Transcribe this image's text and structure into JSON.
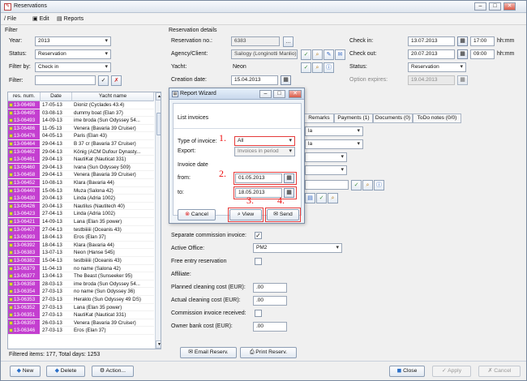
{
  "window": {
    "title": "Reservations"
  },
  "menu": {
    "file": "File",
    "edit": "Edit",
    "reports": "Reports"
  },
  "filter": {
    "section": "Filter",
    "year_label": "Year:",
    "year_value": "2013",
    "status_label": "Status:",
    "status_value": "Reservation",
    "filterby_label": "Filter by:",
    "filterby_value": "Check in",
    "filter_label": "Filter:",
    "filter_value": ""
  },
  "details": {
    "section": "Reservation details",
    "res_no_label": "Reservation no.:",
    "res_no_value": "6383",
    "agency_label": "Agency/Client:",
    "agency_value": "Sailogy (Longinotti Manlio)",
    "yacht_label": "Yacht:",
    "yacht_value": "Neon",
    "creation_label": "Creation date:",
    "creation_value": "15.04.2013",
    "checkin_label": "Check in:",
    "checkin_date": "13.07.2013",
    "checkin_time": "17:00",
    "checkin_unit": "hh:mm",
    "checkout_label": "Check out:",
    "checkout_date": "20.07.2013",
    "checkout_time": "09:00",
    "checkout_unit": "hh:mm",
    "status_label": "Status:",
    "status_value": "Reservation",
    "option_label": "Option expires:",
    "option_value": "19.04.2013"
  },
  "tabs": [
    "Remarks",
    "Payments (1)",
    "Documents (0)",
    "ToDo notes (0/0)"
  ],
  "form": {
    "combo_value": "la",
    "separate_commission": "Separate commission invoice:",
    "active_office_label": "Active Office:",
    "active_office_value": "PM2",
    "free_entry": "Free entry reservation",
    "affiliate": "Affiliate:",
    "planned_cleaning_label": "Planned cleaning cost (EUR):",
    "planned_cleaning_value": ".00",
    "actual_cleaning_label": "Actual cleaning cost (EUR):",
    "actual_cleaning_value": ".00",
    "commission_received": "Commission invoice received:",
    "owner_bank_label": "Owner bank cost (EUR):",
    "owner_bank_value": ".00",
    "email_button": "Email Reserv.",
    "print_button": "Print Reserv."
  },
  "grid": {
    "headers": [
      "res. num.",
      "Date",
      "Yacht name"
    ],
    "rows": [
      [
        "13-06498",
        "17-05-13",
        "Dioniz (Cyclades 43.4)"
      ],
      [
        "13-06495",
        "03-08-13",
        "dummy boat (Elan 37)"
      ],
      [
        "13-06493",
        "14-09-13",
        "ime broda (Sun Odyssey 54..."
      ],
      [
        "13-06486",
        "11-05-13",
        "Venera (Bavaria 39 Cruiser)"
      ],
      [
        "13-06476",
        "04-05-13",
        "Paris (Elan 43)"
      ],
      [
        "13-06464",
        "29-04-13",
        "B 37 cr (Bavaria 37 Cruiser)"
      ],
      [
        "13-06462",
        "29-04-13",
        "König (ACM Dufour Dynasty..."
      ],
      [
        "13-06461",
        "29-04-13",
        "NautiKat (Nauticat 331)"
      ],
      [
        "13-06460",
        "29-04-13",
        "Ivana (Sun Odyssey 509)"
      ],
      [
        "13-06458",
        "29-04-13",
        "Venera (Bavaria 39 Cruiser)"
      ],
      [
        "13-06452",
        "10-08-13",
        "Klara (Bavaria 44)"
      ],
      [
        "13-06440",
        "15-06-13",
        "Muza (Salona 42)"
      ],
      [
        "13-06430",
        "20-04-13",
        "Linda (Adria 1002)"
      ],
      [
        "13-06426",
        "20-04-13",
        "Nautilus (Nautitech 40)"
      ],
      [
        "13-06423",
        "27-04-13",
        "Linda (Adria 1002)"
      ],
      [
        "13-06421",
        "14-09-13",
        "Lana (Elan 35 power)"
      ],
      [
        "13-06407",
        "27-04-13",
        "testbiiiiii (Oceanis 43)"
      ],
      [
        "13-06393",
        "18-04-13",
        "Eros (Elan 37)"
      ],
      [
        "13-06392",
        "18-04-13",
        "Klara (Bavaria 44)"
      ],
      [
        "13-06383",
        "13-07-13",
        "Neon (Hanse 545)"
      ],
      [
        "13-06382",
        "15-04-13",
        "testbiiiiii (Oceanis 43)"
      ],
      [
        "13-06379",
        "11-04-13",
        "no name (Salona 42)"
      ],
      [
        "13-06377",
        "13-04-13",
        "The Beast (Sunseeker 95)"
      ],
      [
        "13-06358",
        "28-03-13",
        "ime broda (Sun Odyssey 54..."
      ],
      [
        "13-06354",
        "27-03-13",
        "no name (Sun Odyssey 36)"
      ],
      [
        "13-06353",
        "27-03-13",
        "Heraklo (Sun Odyssey 49 DS)"
      ],
      [
        "13-06352",
        "27-03-13",
        "Lana (Elan 35 power)"
      ],
      [
        "13-06351",
        "27-03-13",
        "NautiKat (Nauticat 331)"
      ],
      [
        "13-06350",
        "26-03-13",
        "Venera (Bavaria 39 Cruiser)"
      ],
      [
        "13-06346",
        "27-03-13",
        "Eros (Elan 37)"
      ]
    ],
    "footer": "Filtered items: 177, Total days: 1253"
  },
  "footer": {
    "new": "New",
    "delete": "Delete",
    "action": "Action...",
    "close": "Close",
    "apply": "Apply",
    "cancel": "Cancel"
  },
  "wizard": {
    "title": "Report Wizard",
    "heading": "List invoices",
    "type_label": "Type of invoice:",
    "type_value": "All",
    "export_label": "Export:",
    "export_value": "Invoices in period",
    "date_section": "Invoice date",
    "from_label": "from:",
    "from_value": "01.05.2013",
    "to_label": "to:",
    "to_value": "18.05.2013",
    "cancel": "Cancel",
    "view": "View",
    "send": "Send",
    "markers": [
      "1.",
      "2.",
      "3.",
      "4."
    ]
  }
}
